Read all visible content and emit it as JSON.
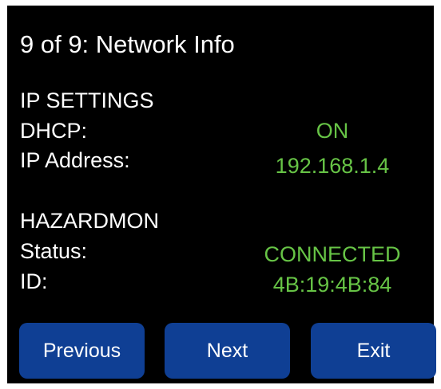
{
  "header": {
    "title": "9 of 9: Network Info"
  },
  "ip_settings": {
    "heading": "IP SETTINGS",
    "dhcp_label": "DHCP:",
    "dhcp_value": "ON",
    "ip_label": "IP Address:",
    "ip_value": "192.168.1.4"
  },
  "hazardmon": {
    "heading": "HAZARDMON",
    "status_label": "Status:",
    "status_value": "CONNECTED",
    "id_label": "ID:",
    "id_value": "4B:19:4B:84"
  },
  "footer": {
    "previous_label": "Previous",
    "next_label": "Next",
    "exit_label": "Exit"
  },
  "colors": {
    "background": "#000000",
    "text": "#ffffff",
    "value_accent": "#67c446",
    "button": "#0f3f94"
  }
}
